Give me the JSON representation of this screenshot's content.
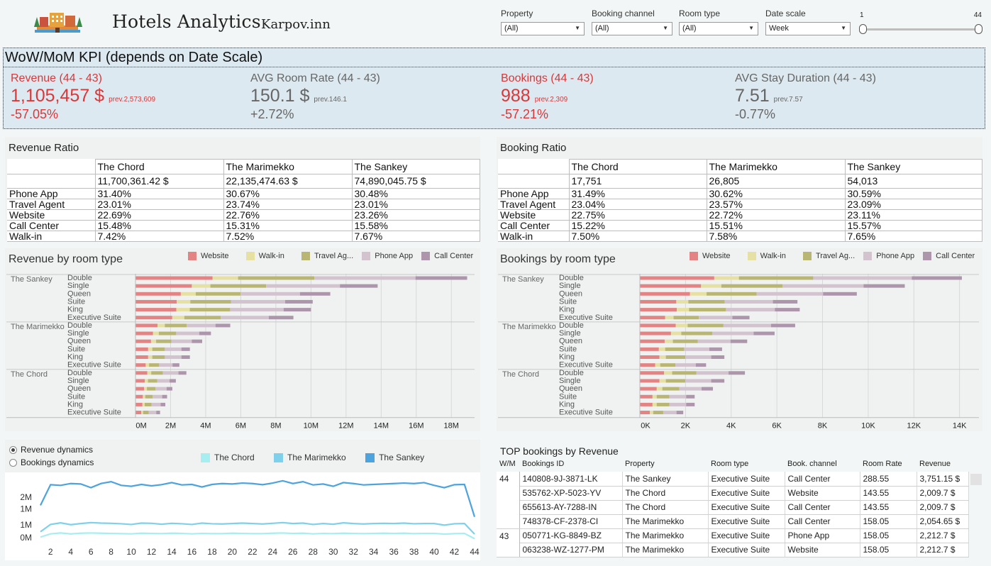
{
  "header": {
    "title": "Hotels Analytics",
    "brand": "Karpov.inn",
    "filters": [
      {
        "label": "Property",
        "value": "(All)"
      },
      {
        "label": "Booking channel",
        "value": "(All)"
      },
      {
        "label": "Room type",
        "value": "(All)"
      },
      {
        "label": "Date scale",
        "value": "Week"
      }
    ],
    "slider": {
      "min_label": "1",
      "max_label": "44",
      "range": [
        1,
        44
      ]
    }
  },
  "kpi": {
    "title": "WoW/MoM KPI (depends on Date Scale)",
    "cards": [
      {
        "label": "Revenue (44 - 43)",
        "value": "1,105,457 $",
        "prev": "prev.2,573,609",
        "change": "-57.05%",
        "negative": true
      },
      {
        "label": "AVG Room Rate (44 - 43)",
        "value": "150.1 $",
        "prev": "prev.146.1",
        "change": "+2.72%",
        "negative": false
      },
      {
        "label": "Bookings (44 - 43)",
        "value": "988",
        "prev": "prev.2,309",
        "change": "-57.21%",
        "negative": true
      },
      {
        "label": "AVG Stay Duration (44 - 43)",
        "value": "7.51",
        "prev": "prev.7.57",
        "change": "-0.77%",
        "negative": false
      }
    ]
  },
  "revenue_ratio": {
    "title": "Revenue Ratio",
    "columns": [
      "The Chord",
      "The Marimekko",
      "The Sankey"
    ],
    "totals": [
      "11,700,361.42 $",
      "22,135,474.63 $",
      "74,890,045.75 $"
    ],
    "rows": [
      {
        "label": "Phone App",
        "values": [
          "31.40%",
          "30.67%",
          "30.48%"
        ]
      },
      {
        "label": "Travel Agent",
        "values": [
          "23.01%",
          "23.74%",
          "23.01%"
        ]
      },
      {
        "label": "Website",
        "values": [
          "22.69%",
          "22.76%",
          "23.26%"
        ]
      },
      {
        "label": "Call Center",
        "values": [
          "15.48%",
          "15.31%",
          "15.58%"
        ]
      },
      {
        "label": "Walk-in",
        "values": [
          "7.42%",
          "7.52%",
          "7.67%"
        ]
      }
    ]
  },
  "booking_ratio": {
    "title": "Booking Ratio",
    "columns": [
      "The Chord",
      "The Marimekko",
      "The Sankey"
    ],
    "totals": [
      "17,751",
      "26,805",
      "54,013"
    ],
    "rows": [
      {
        "label": "Phone App",
        "values": [
          "31.49%",
          "30.62%",
          "30.59%"
        ]
      },
      {
        "label": "Travel Agent",
        "values": [
          "23.04%",
          "23.57%",
          "23.09%"
        ]
      },
      {
        "label": "Website",
        "values": [
          "22.75%",
          "22.72%",
          "23.11%"
        ]
      },
      {
        "label": "Call Center",
        "values": [
          "15.22%",
          "15.51%",
          "15.57%"
        ]
      },
      {
        "label": "Walk-in",
        "values": [
          "7.50%",
          "7.58%",
          "7.65%"
        ]
      }
    ]
  },
  "colors": {
    "Website": "#e38384",
    "Walk-in": "#e6e0a2",
    "Travel Agent": "#b9b674",
    "Phone App": "#d3c3cf",
    "Call Center": "#ad96ac",
    "The Chord": "#a6eef0",
    "The Marimekko": "#7fd0ea",
    "The Sankey": "#4da3dd"
  },
  "chart_data": [
    {
      "type": "bar",
      "orientation": "horizontal",
      "stacked": true,
      "title": "Revenue by room type",
      "legend": [
        "Website",
        "Walk-in",
        "Travel Ag...",
        "Phone App",
        "Call Center"
      ],
      "series_keys": [
        "Website",
        "Walk-in",
        "Travel Agent",
        "Phone App",
        "Call Center"
      ],
      "groups": [
        "The Sankey",
        "The Marimekko",
        "The Chord"
      ],
      "categories": [
        "Double",
        "Single",
        "Queen",
        "Suite",
        "King",
        "Executive Suite"
      ],
      "xlim": [
        0,
        19000000
      ],
      "xticks": [
        0,
        2000000,
        4000000,
        6000000,
        8000000,
        10000000,
        12000000,
        14000000,
        16000000,
        18000000
      ],
      "xtick_labels": [
        "0M",
        "2M",
        "4M",
        "6M",
        "8M",
        "10M",
        "12M",
        "14M",
        "16M",
        "18M"
      ],
      "totals": {
        "The Sankey": [
          18900000,
          13800000,
          11100000,
          10100000,
          10000000,
          9000000
        ],
        "The Marimekko": [
          5400000,
          4300000,
          3800000,
          3100000,
          3100000,
          2500000
        ],
        "The Chord": [
          2900000,
          2300000,
          2100000,
          1800000,
          1700000,
          1400000
        ]
      },
      "shares": [
        0.2326,
        0.0767,
        0.2301,
        0.3048,
        0.1558
      ]
    },
    {
      "type": "bar",
      "orientation": "horizontal",
      "stacked": true,
      "title": "Bookings by room type",
      "legend": [
        "Website",
        "Walk-in",
        "Travel Ag...",
        "Phone App",
        "Call Center"
      ],
      "series_keys": [
        "Website",
        "Walk-in",
        "Travel Agent",
        "Phone App",
        "Call Center"
      ],
      "groups": [
        "The Sankey",
        "The Marimekko",
        "The Chord"
      ],
      "categories": [
        "Double",
        "Single",
        "Queen",
        "Suite",
        "King",
        "Executive Suite"
      ],
      "xlim": [
        0,
        14600
      ],
      "xticks": [
        0,
        2000,
        4000,
        6000,
        8000,
        10000,
        12000,
        14000
      ],
      "xtick_labels": [
        "0K",
        "2K",
        "4K",
        "6K",
        "8K",
        "10K",
        "12K",
        "14K"
      ],
      "totals": {
        "The Sankey": [
          14100,
          11600,
          9500,
          6900,
          7000,
          4800
        ],
        "The Marimekko": [
          6800,
          5900,
          4700,
          3600,
          3700,
          2900
        ],
        "The Chord": [
          4600,
          3700,
          3200,
          2400,
          2400,
          1900
        ]
      },
      "shares": [
        0.2311,
        0.0765,
        0.2309,
        0.3059,
        0.1557
      ]
    },
    {
      "type": "line",
      "title": "",
      "x": [
        1,
        2,
        3,
        4,
        5,
        6,
        7,
        8,
        9,
        10,
        11,
        12,
        13,
        14,
        15,
        16,
        17,
        18,
        19,
        20,
        21,
        22,
        23,
        24,
        25,
        26,
        27,
        28,
        29,
        30,
        31,
        32,
        33,
        34,
        35,
        36,
        37,
        38,
        39,
        40,
        41,
        42,
        43,
        44
      ],
      "xticks": [
        2,
        4,
        6,
        8,
        10,
        12,
        14,
        16,
        18,
        20,
        22,
        24,
        26,
        28,
        30,
        32,
        34,
        36,
        38,
        40,
        42,
        44
      ],
      "ytick_labels": [
        "2M",
        "1M",
        "1M",
        "0M"
      ],
      "ylim": [
        0,
        2900000
      ],
      "series": [
        {
          "name": "The Sankey",
          "values": [
            1650000,
            2550000,
            2520000,
            2600000,
            2580000,
            2420000,
            2600000,
            2680000,
            2520000,
            2480000,
            2560000,
            2500000,
            2550000,
            2640000,
            2540000,
            2560000,
            2450000,
            2560000,
            2600000,
            2580000,
            2620000,
            2600000,
            2550000,
            2620000,
            2720000,
            2600000,
            2680000,
            2540000,
            2580000,
            2480000,
            2640000,
            2600000,
            2540000,
            2560000,
            2580000,
            2600000,
            2620000,
            2600000,
            2640000,
            2520000,
            2420000,
            2550000,
            2560000,
            1150000
          ]
        },
        {
          "name": "The Marimekko",
          "values": [
            500000,
            820000,
            890000,
            810000,
            860000,
            900000,
            880000,
            870000,
            850000,
            820000,
            880000,
            870000,
            830000,
            870000,
            850000,
            820000,
            880000,
            850000,
            840000,
            860000,
            880000,
            860000,
            840000,
            870000,
            900000,
            860000,
            880000,
            820000,
            860000,
            830000,
            890000,
            860000,
            840000,
            860000,
            870000,
            860000,
            880000,
            850000,
            860000,
            860000,
            790000,
            850000,
            860000,
            400000
          ]
        },
        {
          "name": "The Chord",
          "values": [
            270000,
            410000,
            450000,
            410000,
            440000,
            450000,
            440000,
            430000,
            420000,
            410000,
            440000,
            430000,
            420000,
            440000,
            430000,
            410000,
            430000,
            420000,
            420000,
            440000,
            430000,
            420000,
            420000,
            440000,
            450000,
            430000,
            440000,
            410000,
            430000,
            420000,
            440000,
            430000,
            420000,
            430000,
            440000,
            430000,
            440000,
            420000,
            430000,
            430000,
            400000,
            420000,
            430000,
            200000
          ]
        }
      ]
    }
  ],
  "line_panel": {
    "options": [
      "Revenue dynamics",
      "Bookings dynamics"
    ],
    "selected": 0,
    "legend": [
      "The Chord",
      "The Marimekko",
      "The Sankey"
    ]
  },
  "top_bookings": {
    "title": "TOP bookings by Revenue",
    "columns": [
      "W/M",
      "Bookings ID",
      "Property",
      "Room type",
      "Book. channel",
      "Room Rate",
      "Revenue"
    ],
    "groups": [
      {
        "wm": "44",
        "rows": [
          [
            "140808-9J-3871-LK",
            "The Sankey",
            "Executive Suite",
            "Call Center",
            "288.55",
            "3,751.15 $"
          ],
          [
            "535762-XP-5023-YV",
            "The Chord",
            "Executive Suite",
            "Website",
            "143.55",
            "2,009.7 $"
          ],
          [
            "655613-AY-7288-IN",
            "The Chord",
            "Executive Suite",
            "Call Center",
            "143.55",
            "2,009.7 $"
          ],
          [
            "748378-CF-2378-CI",
            "The Marimekko",
            "Executive Suite",
            "Call Center",
            "158.05",
            "2,054.65 $"
          ]
        ]
      },
      {
        "wm": "43",
        "rows": [
          [
            "050771-KG-8849-BZ",
            "The Marimekko",
            "Executive Suite",
            "Phone App",
            "158.05",
            "2,212.7 $"
          ],
          [
            "063238-WZ-1277-PM",
            "The Marimekko",
            "Executive Suite",
            "Website",
            "158.05",
            "2,212.7 $"
          ]
        ]
      }
    ]
  }
}
